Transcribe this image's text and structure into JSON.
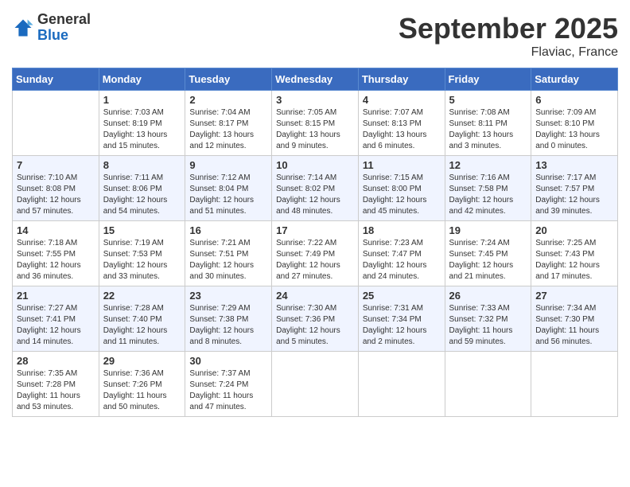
{
  "header": {
    "logo_general": "General",
    "logo_blue": "Blue",
    "month_title": "September 2025",
    "location": "Flaviac, France"
  },
  "days_of_week": [
    "Sunday",
    "Monday",
    "Tuesday",
    "Wednesday",
    "Thursday",
    "Friday",
    "Saturday"
  ],
  "weeks": [
    [
      {
        "day": "",
        "info": ""
      },
      {
        "day": "1",
        "info": "Sunrise: 7:03 AM\nSunset: 8:19 PM\nDaylight: 13 hours\nand 15 minutes."
      },
      {
        "day": "2",
        "info": "Sunrise: 7:04 AM\nSunset: 8:17 PM\nDaylight: 13 hours\nand 12 minutes."
      },
      {
        "day": "3",
        "info": "Sunrise: 7:05 AM\nSunset: 8:15 PM\nDaylight: 13 hours\nand 9 minutes."
      },
      {
        "day": "4",
        "info": "Sunrise: 7:07 AM\nSunset: 8:13 PM\nDaylight: 13 hours\nand 6 minutes."
      },
      {
        "day": "5",
        "info": "Sunrise: 7:08 AM\nSunset: 8:11 PM\nDaylight: 13 hours\nand 3 minutes."
      },
      {
        "day": "6",
        "info": "Sunrise: 7:09 AM\nSunset: 8:10 PM\nDaylight: 13 hours\nand 0 minutes."
      }
    ],
    [
      {
        "day": "7",
        "info": "Sunrise: 7:10 AM\nSunset: 8:08 PM\nDaylight: 12 hours\nand 57 minutes."
      },
      {
        "day": "8",
        "info": "Sunrise: 7:11 AM\nSunset: 8:06 PM\nDaylight: 12 hours\nand 54 minutes."
      },
      {
        "day": "9",
        "info": "Sunrise: 7:12 AM\nSunset: 8:04 PM\nDaylight: 12 hours\nand 51 minutes."
      },
      {
        "day": "10",
        "info": "Sunrise: 7:14 AM\nSunset: 8:02 PM\nDaylight: 12 hours\nand 48 minutes."
      },
      {
        "day": "11",
        "info": "Sunrise: 7:15 AM\nSunset: 8:00 PM\nDaylight: 12 hours\nand 45 minutes."
      },
      {
        "day": "12",
        "info": "Sunrise: 7:16 AM\nSunset: 7:58 PM\nDaylight: 12 hours\nand 42 minutes."
      },
      {
        "day": "13",
        "info": "Sunrise: 7:17 AM\nSunset: 7:57 PM\nDaylight: 12 hours\nand 39 minutes."
      }
    ],
    [
      {
        "day": "14",
        "info": "Sunrise: 7:18 AM\nSunset: 7:55 PM\nDaylight: 12 hours\nand 36 minutes."
      },
      {
        "day": "15",
        "info": "Sunrise: 7:19 AM\nSunset: 7:53 PM\nDaylight: 12 hours\nand 33 minutes."
      },
      {
        "day": "16",
        "info": "Sunrise: 7:21 AM\nSunset: 7:51 PM\nDaylight: 12 hours\nand 30 minutes."
      },
      {
        "day": "17",
        "info": "Sunrise: 7:22 AM\nSunset: 7:49 PM\nDaylight: 12 hours\nand 27 minutes."
      },
      {
        "day": "18",
        "info": "Sunrise: 7:23 AM\nSunset: 7:47 PM\nDaylight: 12 hours\nand 24 minutes."
      },
      {
        "day": "19",
        "info": "Sunrise: 7:24 AM\nSunset: 7:45 PM\nDaylight: 12 hours\nand 21 minutes."
      },
      {
        "day": "20",
        "info": "Sunrise: 7:25 AM\nSunset: 7:43 PM\nDaylight: 12 hours\nand 17 minutes."
      }
    ],
    [
      {
        "day": "21",
        "info": "Sunrise: 7:27 AM\nSunset: 7:41 PM\nDaylight: 12 hours\nand 14 minutes."
      },
      {
        "day": "22",
        "info": "Sunrise: 7:28 AM\nSunset: 7:40 PM\nDaylight: 12 hours\nand 11 minutes."
      },
      {
        "day": "23",
        "info": "Sunrise: 7:29 AM\nSunset: 7:38 PM\nDaylight: 12 hours\nand 8 minutes."
      },
      {
        "day": "24",
        "info": "Sunrise: 7:30 AM\nSunset: 7:36 PM\nDaylight: 12 hours\nand 5 minutes."
      },
      {
        "day": "25",
        "info": "Sunrise: 7:31 AM\nSunset: 7:34 PM\nDaylight: 12 hours\nand 2 minutes."
      },
      {
        "day": "26",
        "info": "Sunrise: 7:33 AM\nSunset: 7:32 PM\nDaylight: 11 hours\nand 59 minutes."
      },
      {
        "day": "27",
        "info": "Sunrise: 7:34 AM\nSunset: 7:30 PM\nDaylight: 11 hours\nand 56 minutes."
      }
    ],
    [
      {
        "day": "28",
        "info": "Sunrise: 7:35 AM\nSunset: 7:28 PM\nDaylight: 11 hours\nand 53 minutes."
      },
      {
        "day": "29",
        "info": "Sunrise: 7:36 AM\nSunset: 7:26 PM\nDaylight: 11 hours\nand 50 minutes."
      },
      {
        "day": "30",
        "info": "Sunrise: 7:37 AM\nSunset: 7:24 PM\nDaylight: 11 hours\nand 47 minutes."
      },
      {
        "day": "",
        "info": ""
      },
      {
        "day": "",
        "info": ""
      },
      {
        "day": "",
        "info": ""
      },
      {
        "day": "",
        "info": ""
      }
    ]
  ]
}
